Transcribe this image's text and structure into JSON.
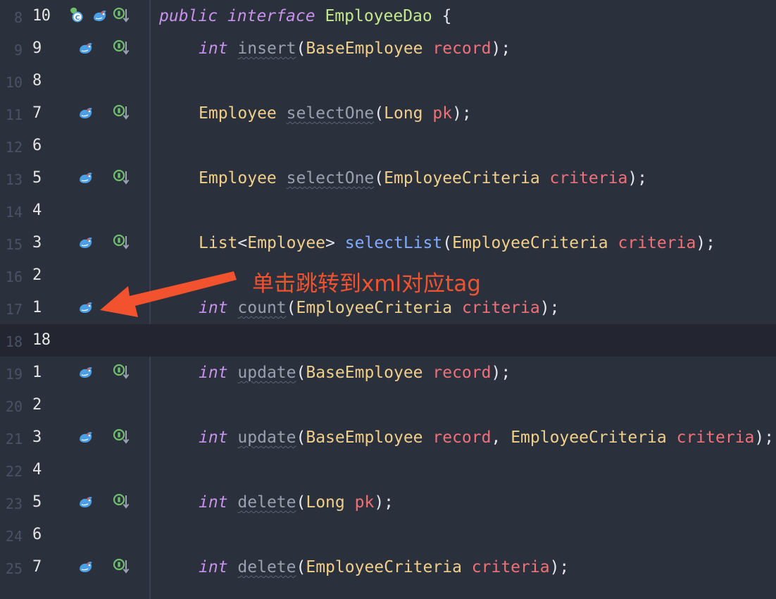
{
  "annotation": {
    "text": "单击跳转到xml对应tag"
  },
  "colors": {
    "background": "#2b303d",
    "current_line": "#232631",
    "keyword": "#c792ea",
    "type": "#f0cf8a",
    "param": "#f07178",
    "method_call": "#82aaff",
    "class_name": "#c3e88d",
    "annotation": "#f2522e",
    "gutter_icon_green": "#6fbe6a",
    "gutter_icon_blue": "#4a9fe6"
  },
  "lines": [
    {
      "abs": "8",
      "rel": "10",
      "icons": [
        "class-icon",
        "mybatis-bird-icon",
        "implemented-icon"
      ],
      "code": "interface_decl"
    },
    {
      "abs": "9",
      "rel": "9",
      "icons": [
        "mybatis-bird-icon",
        "implemented-icon"
      ]
    },
    {
      "abs": "10",
      "rel": "8",
      "icons": []
    },
    {
      "abs": "11",
      "rel": "7",
      "icons": [
        "mybatis-bird-icon",
        "implemented-icon"
      ]
    },
    {
      "abs": "12",
      "rel": "6",
      "icons": []
    },
    {
      "abs": "13",
      "rel": "5",
      "icons": [
        "mybatis-bird-icon",
        "implemented-icon"
      ]
    },
    {
      "abs": "14",
      "rel": "4",
      "icons": []
    },
    {
      "abs": "15",
      "rel": "3",
      "icons": [
        "mybatis-bird-icon",
        "implemented-icon"
      ]
    },
    {
      "abs": "16",
      "rel": "2",
      "icons": []
    },
    {
      "abs": "17",
      "rel": "1",
      "icons": [
        "mybatis-bird-icon",
        "implemented-icon"
      ]
    },
    {
      "abs": "18",
      "rel": "18",
      "icons": [],
      "current": true
    },
    {
      "abs": "19",
      "rel": "1",
      "icons": [
        "mybatis-bird-icon",
        "implemented-icon"
      ]
    },
    {
      "abs": "20",
      "rel": "2",
      "icons": []
    },
    {
      "abs": "21",
      "rel": "3",
      "icons": [
        "mybatis-bird-icon",
        "implemented-icon"
      ]
    },
    {
      "abs": "22",
      "rel": "4",
      "icons": []
    },
    {
      "abs": "23",
      "rel": "5",
      "icons": [
        "mybatis-bird-icon",
        "implemented-icon"
      ]
    },
    {
      "abs": "24",
      "rel": "6",
      "icons": []
    },
    {
      "abs": "25",
      "rel": "7",
      "icons": [
        "mybatis-bird-icon",
        "implemented-icon"
      ]
    }
  ],
  "code": {
    "l8": {
      "kw1": "public",
      "kw2": "interface",
      "name": "EmployeeDao",
      "brace": "{"
    },
    "l9": {
      "ret": "int",
      "method": "insert",
      "open": "(",
      "ptype": "BaseEmployee",
      "pname": "record",
      "close": ");"
    },
    "l11": {
      "ret": "Employee",
      "method": "selectOne",
      "open": "(",
      "ptype": "Long",
      "pname": "pk",
      "close": ");"
    },
    "l13": {
      "ret": "Employee",
      "method": "selectOne",
      "open": "(",
      "ptype": "EmployeeCriteria",
      "pname": "criteria",
      "close": ");"
    },
    "l15": {
      "ret": "List",
      "lt": "<",
      "generic": "Employee",
      "gt": ">",
      "method": "selectList",
      "open": "(",
      "ptype": "EmployeeCriteria",
      "pname": "criteria",
      "close": ");"
    },
    "l17": {
      "ret": "int",
      "method": "count",
      "open": "(",
      "ptype": "EmployeeCriteria",
      "pname": "criteria",
      "close": ");"
    },
    "l19": {
      "ret": "int",
      "method": "update",
      "open": "(",
      "ptype": "BaseEmployee",
      "pname": "record",
      "close": ");"
    },
    "l21": {
      "ret": "int",
      "method": "update",
      "open": "(",
      "ptype": "BaseEmployee",
      "pname": "record",
      "comma": ", ",
      "ptype2": "EmployeeCriteria",
      "pname2": "criteria",
      "close": ");"
    },
    "l23": {
      "ret": "int",
      "method": "delete",
      "open": "(",
      "ptype": "Long",
      "pname": "pk",
      "close": ");"
    },
    "l25": {
      "ret": "int",
      "method": "delete",
      "open": "(",
      "ptype": "EmployeeCriteria",
      "pname": "criteria",
      "close": ");"
    }
  }
}
